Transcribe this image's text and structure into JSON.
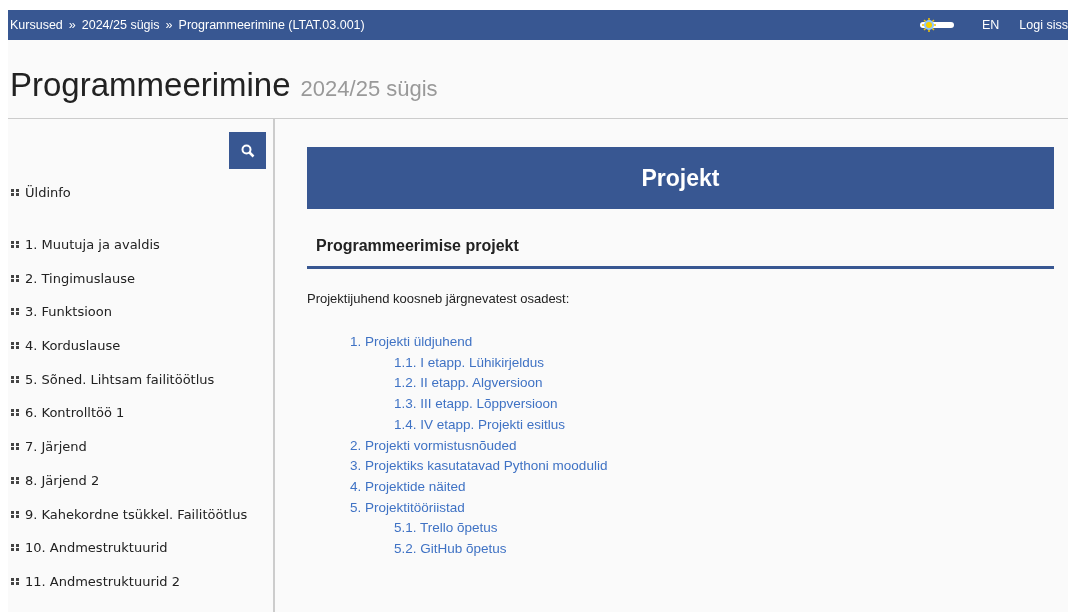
{
  "top_bar": {
    "breadcrumbs": [
      "Kursused",
      "2024/25 sügis",
      "Programmeerimine (LTAT.03.001)"
    ],
    "separator": "»",
    "theme_switch": {
      "on": false
    },
    "language": "EN",
    "login": "Logi siss"
  },
  "page_title": {
    "title": "Programmeerimine",
    "subtitle": "2024/25 sügis"
  },
  "sidebar": {
    "items": [
      {
        "label": "Üldinfo",
        "kind": "group"
      },
      {
        "label": "1. Muutuja ja avaldis",
        "kind": "lesson"
      },
      {
        "label": "2. Tingimuslause",
        "kind": "lesson"
      },
      {
        "label": "3. Funktsioon",
        "kind": "lesson"
      },
      {
        "label": "4. Korduslause",
        "kind": "lesson"
      },
      {
        "label": "5. Sõned. Lihtsam failitöötlus",
        "kind": "lesson"
      },
      {
        "label": "6. Kontrolltöö 1",
        "kind": "lesson"
      },
      {
        "label": "7. Järjend",
        "kind": "lesson"
      },
      {
        "label": "8. Järjend 2",
        "kind": "lesson"
      },
      {
        "label": "9. Kahekordne tsükkel. Failitöötlus",
        "kind": "lesson"
      },
      {
        "label": "10. Andmestruktuurid",
        "kind": "lesson"
      },
      {
        "label": "11. Andmestruktuurid 2",
        "kind": "lesson"
      }
    ]
  },
  "content": {
    "banner": "Projekt",
    "section_title": "Programmeerimise projekt",
    "intro": "Projektijuhend koosneb järgnevatest osadest:",
    "toc": [
      {
        "label": "1. Projekti üldjuhend",
        "children": [
          {
            "label": "1.1. I etapp. Lühikirjeldus"
          },
          {
            "label": "1.2. II etapp. Algversioon"
          },
          {
            "label": "1.3. III etapp. Lõppversioon"
          },
          {
            "label": "1.4. IV etapp. Projekti esitlus"
          }
        ]
      },
      {
        "label": "2. Projekti vormistusnõuded"
      },
      {
        "label": "3. Projektiks kasutatavad Pythoni moodulid"
      },
      {
        "label": "4. Projektide näited"
      },
      {
        "label": "5. Projektitööriistad",
        "children": [
          {
            "label": "5.1. Trello õpetus"
          },
          {
            "label": "5.2. GitHub õpetus"
          }
        ]
      }
    ]
  }
}
